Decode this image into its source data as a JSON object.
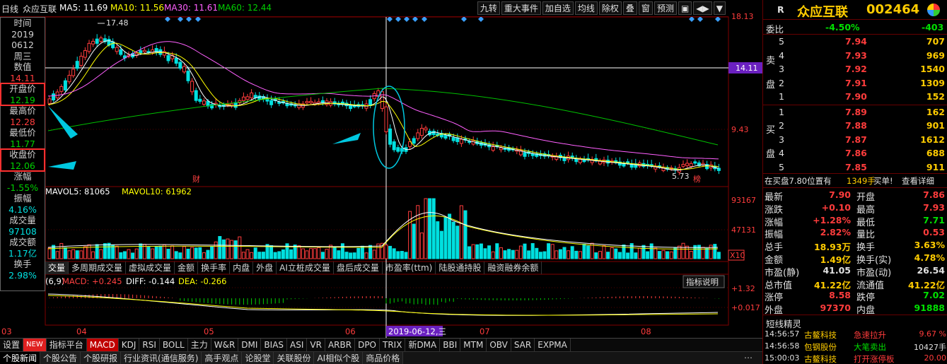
{
  "header": {
    "title_label": "日线",
    "stock_name": "众应互联",
    "ma5": "MA5: 11.69",
    "ma10": "MA10: 11.56",
    "ma30": "MA30: 11.61",
    "ma60": "MA60: 12.44",
    "buttons": [
      "九转",
      "重大事件",
      "加自选",
      "均线",
      "除权",
      "叠",
      "窗",
      "预测"
    ]
  },
  "price_axis": {
    "top": "18.13",
    "mid": "14.11",
    "low": "9.43",
    "hl_label": "14.11"
  },
  "annotations": {
    "high_label": "17.48",
    "low_label": "5.73",
    "fin_label": "财",
    "rank_label": "榜"
  },
  "volume": {
    "label_ma5": "MAVOL5: 81065",
    "label_ma10": "MAVOL10: 61962",
    "top": "93167",
    "mid": "47131",
    "unit": "X10"
  },
  "macd": {
    "params": "(6,9)",
    "macd": "MACD: +0.245",
    "diff": "DIFF: -0.144",
    "dea": "DEA: -0.266",
    "top": "+1.32",
    "mid": "+0.017",
    "explain": "指标说明"
  },
  "vol_tabs": [
    "交量",
    "多周期成交量",
    "虚拟成交量",
    "金额",
    "换手率",
    "内盘",
    "外盘",
    "AI立桩成交量",
    "盘后成交量",
    "市盈率(ttm)",
    "陆股通持股",
    "融资融券余额"
  ],
  "time_axis": {
    "labels": [
      "03",
      "04",
      "05",
      "06",
      "07",
      "08"
    ],
    "cursor_date": "2019-06-12,三"
  },
  "left_info": {
    "time_label": "时间",
    "year": "2019",
    "date": "0612",
    "weekday": "周三",
    "value_label": "数值",
    "value": "14.11",
    "open_label": "开盘价",
    "open": "12.19",
    "high_label": "最高价",
    "high": "12.28",
    "low_label": "最低价",
    "low": "11.77",
    "close_label": "收盘价",
    "close": "12.06",
    "chg_label": "涨幅",
    "chg": "-1.55%",
    "amp_label": "振幅",
    "amp": "4.16%",
    "vol_label": "成交量",
    "vol": "97108",
    "amt_label": "成交额",
    "amt": "1.17亿",
    "turn_label": "换手",
    "turn": "2.98%"
  },
  "right_panel": {
    "r_label": "R",
    "name": "众应互联",
    "code": "002464",
    "weibi_label": "委比",
    "weibi": "-4.50%",
    "weicha": "-403",
    "sell_side_label": [
      "卖",
      "盘"
    ],
    "buy_side_label": [
      "买",
      "盘"
    ],
    "sell": [
      {
        "lvl": "5",
        "price": "7.94",
        "vol": "707"
      },
      {
        "lvl": "4",
        "price": "7.93",
        "vol": "969"
      },
      {
        "lvl": "3",
        "price": "7.92",
        "vol": "1540"
      },
      {
        "lvl": "2",
        "price": "7.91",
        "vol": "1309"
      },
      {
        "lvl": "1",
        "price": "7.90",
        "vol": "152"
      }
    ],
    "buy": [
      {
        "lvl": "1",
        "price": "7.89",
        "vol": "162"
      },
      {
        "lvl": "2",
        "price": "7.88",
        "vol": "901"
      },
      {
        "lvl": "3",
        "price": "7.87",
        "vol": "1612"
      },
      {
        "lvl": "4",
        "price": "7.86",
        "vol": "688"
      },
      {
        "lvl": "5",
        "price": "7.85",
        "vol": "911"
      }
    ],
    "bid_note": "在买盘7.80位置有",
    "bid_note_vol": "1349手",
    "bid_note_tail": "买单!",
    "detail_link": "查看详细",
    "stats": [
      {
        "l1": "最新",
        "v1": "7.90",
        "l2": "开盘",
        "v2": "7.86"
      },
      {
        "l1": "涨跌",
        "v1": "+0.10",
        "l2": "最高",
        "v2": "7.93"
      },
      {
        "l1": "涨幅",
        "v1": "+1.28%",
        "l2": "最低",
        "v2": "7.71"
      },
      {
        "l1": "振幅",
        "v1": "2.82%",
        "l2": "量比",
        "v2": "0.53"
      },
      {
        "l1": "总手",
        "v1": "18.93万",
        "l2": "换手",
        "v2": "3.63%"
      },
      {
        "l1": "金额",
        "v1": "1.49亿",
        "l2": "换手(实)",
        "v2": "4.78%"
      },
      {
        "l1": "市盈(静)",
        "v1": "41.05",
        "l2": "市盈(动)",
        "v2": "26.54"
      },
      {
        "l1": "总市值",
        "v1": "41.22亿",
        "l2": "流通值",
        "v2": "41.22亿"
      },
      {
        "l1": "涨停",
        "v1": "8.58",
        "l2": "跌停",
        "v2": "7.02"
      },
      {
        "l1": "外盘",
        "v1": "97370",
        "l2": "内盘",
        "v2": "91888"
      }
    ],
    "sprite_title": "短线精灵",
    "sprite_rows": [
      {
        "time": "14:56:57",
        "name": "古鳌科技",
        "event": "急速拉升",
        "value": "9.67 %"
      },
      {
        "time": "14:56:58",
        "name": "包钢股份",
        "event": "大笔卖出",
        "value": "10427手"
      },
      {
        "time": "15:00:03",
        "name": "古鳌科技",
        "event": "打开涨停板",
        "value": "20.00"
      }
    ]
  },
  "bottom_tabs": [
    "设置",
    "NEW",
    "指标平台",
    "MACD",
    "KDJ",
    "RSI",
    "BOLL",
    "主力",
    "W&R",
    "DMI",
    "BIAS",
    "ASI",
    "VR",
    "ARBR",
    "DPO",
    "TRIX",
    "新DMA",
    "BBI",
    "MTM",
    "OBV",
    "SAR",
    "EXPMA"
  ],
  "news_tabs": [
    "个股新闻",
    "个股公告",
    "个股研报",
    "行业资讯(通信服务)",
    "高手观点",
    "论股堂",
    "关联股份",
    "AI相似个股",
    "商品价格"
  ],
  "colors": {
    "bg": "#000000",
    "up": "#ff3c3c",
    "down": "#00e0e0",
    "ma5": "#ffffff",
    "ma10": "#ffff00",
    "ma30": "#ff60ff",
    "ma60": "#00c000",
    "accent": "#ffcc00"
  }
}
